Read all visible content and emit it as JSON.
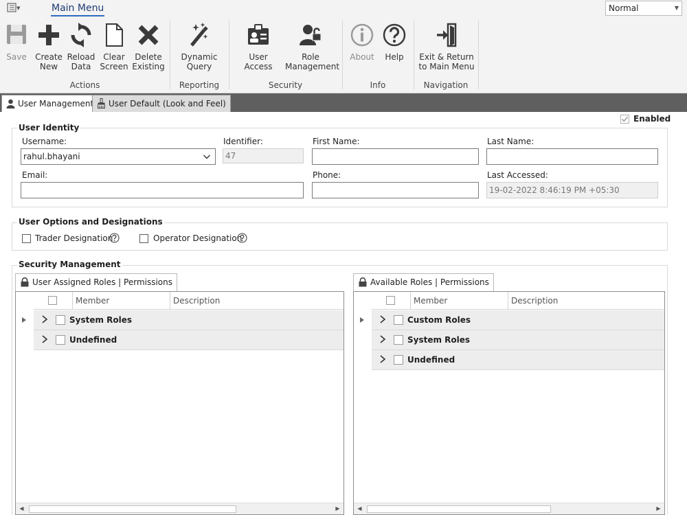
{
  "ribbon": {
    "tab": "Main Menu",
    "style_select": "Normal",
    "groups": {
      "actions": "Actions",
      "reporting": "Reporting",
      "security": "Security",
      "info": "Info",
      "navigation": "Navigation"
    },
    "buttons": {
      "save": "Save",
      "create_new_1": "Create",
      "create_new_2": "New",
      "reload_1": "Reload",
      "reload_2": "Data",
      "clear_1": "Clear",
      "clear_2": "Screen",
      "delete_1": "Delete",
      "delete_2": "Existing",
      "dq_1": "Dynamic",
      "dq_2": "Query",
      "user_access": "User Access",
      "role_1": "Role",
      "role_2": "Management",
      "about": "About",
      "help": "Help",
      "exit_1": "Exit & Return",
      "exit_2": "to Main Menu"
    }
  },
  "doc_tabs": {
    "user_management": "User Management",
    "user_default": "User Default (Look and Feel)"
  },
  "enabled_label": "Enabled",
  "identity": {
    "legend": "User Identity",
    "username_label": "Username:",
    "username_value": "rahul.bhayani",
    "identifier_label": "Identifier:",
    "identifier_value": "47",
    "first_name_label": "First Name:",
    "first_name_value": "",
    "last_name_label": "Last Name:",
    "last_name_value": "",
    "email_label": "Email:",
    "email_value": "",
    "phone_label": "Phone:",
    "phone_value": "",
    "last_accessed_label": "Last Accessed:",
    "last_accessed_value": "19-02-2022 8:46:19 PM +05:30"
  },
  "options": {
    "legend": "User Options and Designations",
    "trader": "Trader Designation",
    "operator": "Operator Designation"
  },
  "security": {
    "legend": "Security Management",
    "assigned_tab": "User Assigned Roles | Permissions",
    "available_tab": "Available Roles | Permissions",
    "col_member": "Member",
    "col_description": "Description",
    "assigned_rows": [
      "System Roles",
      "Undefined"
    ],
    "available_rows": [
      "Custom Roles",
      "System Roles",
      "Undefined"
    ]
  },
  "colors": {
    "accent": "#2b6cc4",
    "ribbon_bg": "#f3f3f3",
    "tab_strip": "#5f5f5f"
  }
}
